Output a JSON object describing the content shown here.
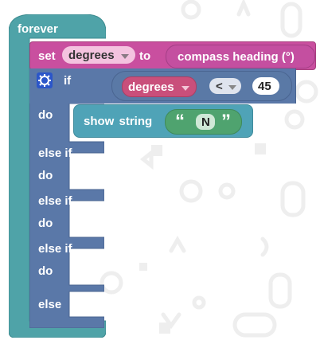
{
  "forever": {
    "label": "forever"
  },
  "set_block": {
    "set_label": "set",
    "variable": "degrees",
    "to_label": "to",
    "value": "compass heading (°)"
  },
  "if_block": {
    "if_label": "if",
    "do_label": "do",
    "condition": {
      "left": "degrees",
      "operator": "<",
      "right": "45"
    },
    "branches": [
      {
        "else_if": "else if",
        "do": "do"
      },
      {
        "else_if": "else if",
        "do": "do"
      },
      {
        "else_if": "else if",
        "do": "do"
      }
    ],
    "else_label": "else"
  },
  "show_string": {
    "label": "show  string",
    "open_quote": "“",
    "value": "N",
    "close_quote": "”"
  },
  "colors": {
    "forever": "#4fa3a8",
    "set": "#c94f9f",
    "if": "#5a78a8",
    "compare": "#5a79a6",
    "show": "#4fa3b7",
    "text": "#4fa36f",
    "variable": "#c94f7b"
  }
}
